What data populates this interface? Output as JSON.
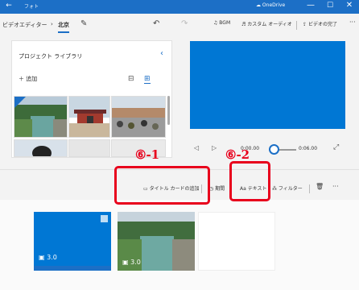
{
  "window": {
    "back_glyph": "←",
    "app_label": "フォト",
    "account": "OneDrive",
    "min_glyph": "—",
    "max_glyph": "☐",
    "close_glyph": "✕"
  },
  "toolbar": {
    "breadcrumb_root": "ビデオエディター",
    "breadcrumb_sep": "›",
    "project_name": "北京",
    "bgm_label": "BGM",
    "custom_audio_label": "カスタム オーディオ",
    "finish_video_label": "ビデオの完了",
    "more_glyph": "···"
  },
  "library": {
    "title": "プロジェクト ライブラリ",
    "add_label": "追加",
    "collapse_glyph": "‹"
  },
  "player": {
    "current_time": "0:00.00",
    "total_time": "0:06.00"
  },
  "actions": {
    "title_card_label": "タイトル カードの追加",
    "duration_label": "期間",
    "text_label": "テキスト",
    "filter_label": "フィルター",
    "more_glyph": "···"
  },
  "storyboard": {
    "cards": [
      {
        "duration": "3.0"
      },
      {
        "duration": "3.0"
      }
    ]
  },
  "annotations": {
    "label_1": "⑥-1",
    "label_2": "⑥-2"
  },
  "colors": {
    "accent": "#1c6fc6",
    "preview": "#0077d4",
    "annotation": "#e8001c"
  }
}
